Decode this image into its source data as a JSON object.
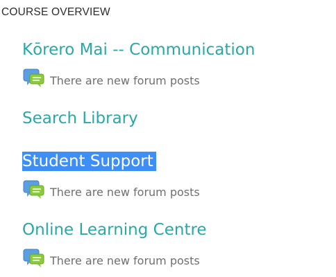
{
  "overview": {
    "title": "COURSE OVERVIEW"
  },
  "courses": [
    {
      "name": "Kōrero Mai -- Communication",
      "notice": "There are new forum posts",
      "icon": "forum-posts-icon"
    },
    {
      "name": "Search Library"
    },
    {
      "name": "Student Support",
      "notice": "There are new forum posts",
      "icon": "forum-posts-icon",
      "selected": true
    },
    {
      "name": "Online Learning Centre",
      "notice": "There are new forum posts",
      "icon": "forum-posts-icon"
    }
  ],
  "colors": {
    "link": "#2aa8a5",
    "selection": "#3d8ef5",
    "notice_text": "#6f6f6f",
    "icon_blue": "#5a9fe0",
    "icon_green": "#8ccb3a"
  }
}
